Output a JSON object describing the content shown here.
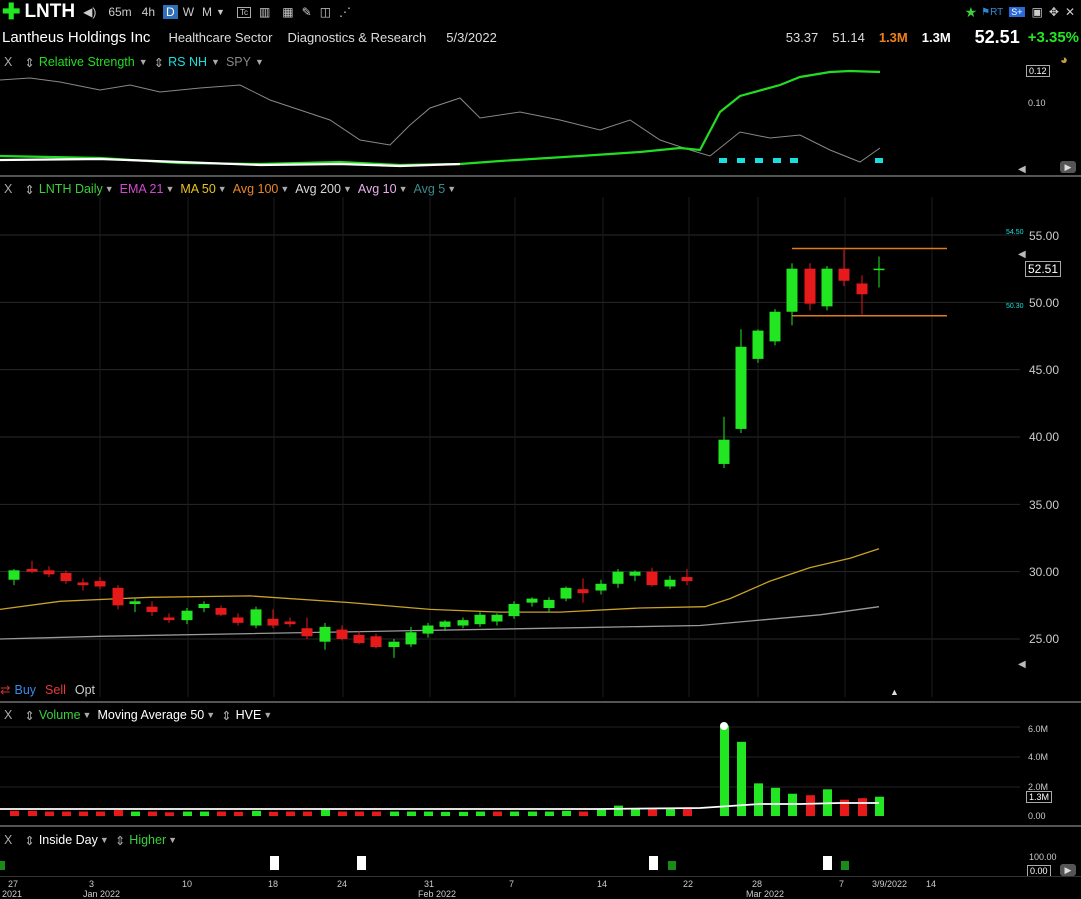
{
  "toolbar": {
    "symbol": "LNTH",
    "timeframes": [
      "65m",
      "4h",
      "D",
      "W",
      "M"
    ],
    "active_timeframe": "D"
  },
  "info": {
    "company": "Lantheus Holdings Inc",
    "sector": "Healthcare Sector",
    "industry": "Diagnostics & Research",
    "date": "5/3/2022",
    "high": "53.37",
    "low": "51.14",
    "vol_orange": "1.3M",
    "vol_white": "1.3M",
    "last": "52.51",
    "change": "+3.35%"
  },
  "rs_pane": {
    "close": "X",
    "label": "Relative Strength",
    "rsnh": "RS NH",
    "spy": "SPY",
    "tick_top": "0.12",
    "tick_mid": "0.10"
  },
  "price_pane": {
    "close": "X",
    "studies": [
      {
        "label": "LNTH Daily",
        "color": "#3ad13a"
      },
      {
        "label": "EMA 21",
        "color": "#d04ad0"
      },
      {
        "label": "MA 50",
        "color": "#e8c41a"
      },
      {
        "label": "Avg 100",
        "color": "#e8872a"
      },
      {
        "label": "Avg 200",
        "color": "#d8d8d8"
      },
      {
        "label": "Avg 10",
        "color": "#e8b0e8"
      },
      {
        "label": "Avg 5",
        "color": "#3a8a8a"
      }
    ],
    "ticks": [
      "55.00",
      "50.00",
      "45.00",
      "40.00",
      "35.00",
      "30.00",
      "25.00"
    ],
    "last_tag": "52.51",
    "level_high": "54.50",
    "level_low": "50.30",
    "buy": "Buy",
    "sell": "Sell",
    "opt": "Opt"
  },
  "volume_pane": {
    "close": "X",
    "label": "Volume",
    "ma": "Moving Average 50",
    "hve": "HVE",
    "ticks": [
      "6.0M",
      "4.0M",
      "2.0M",
      "0.00"
    ],
    "last_tag": "1.3M"
  },
  "inside_pane": {
    "close": "X",
    "label": "Inside Day",
    "higher": "Higher",
    "tick_top": "100.00",
    "tick_bot": "0.00"
  },
  "xaxis": {
    "labels": [
      {
        "t": "27",
        "sub": "2021"
      },
      {
        "t": "3",
        "sub": "Jan 2022"
      },
      {
        "t": "10",
        "sub": ""
      },
      {
        "t": "18",
        "sub": ""
      },
      {
        "t": "24",
        "sub": ""
      },
      {
        "t": "31",
        "sub": "Feb 2022"
      },
      {
        "t": "7",
        "sub": ""
      },
      {
        "t": "14",
        "sub": ""
      },
      {
        "t": "22",
        "sub": ""
      },
      {
        "t": "28",
        "sub": "Mar 2022"
      },
      {
        "t": "7",
        "sub": ""
      },
      {
        "t": "3/9/2022",
        "sub": ""
      },
      {
        "t": "14",
        "sub": ""
      }
    ]
  },
  "colors": {
    "up": "#22e622",
    "down": "#e61a1a",
    "ma50": "#c9a227",
    "ma200": "#9a9a9a",
    "level": "#e07a1a",
    "rs_line": "#22dd22",
    "spy_line": "#888888",
    "rsnh": "#19e0e0"
  },
  "chart_data": {
    "type": "candlestick",
    "ylim": [
      23,
      57
    ],
    "candles": [
      {
        "o": 29.4,
        "h": 30.2,
        "l": 29.0,
        "c": 30.1
      },
      {
        "o": 30.2,
        "h": 30.8,
        "l": 29.9,
        "c": 30.0
      },
      {
        "o": 30.1,
        "h": 30.4,
        "l": 29.6,
        "c": 29.8
      },
      {
        "o": 29.9,
        "h": 30.1,
        "l": 29.1,
        "c": 29.3
      },
      {
        "o": 29.2,
        "h": 29.5,
        "l": 28.6,
        "c": 29.0
      },
      {
        "o": 29.3,
        "h": 29.6,
        "l": 28.7,
        "c": 28.9
      },
      {
        "o": 28.8,
        "h": 29.0,
        "l": 27.2,
        "c": 27.5
      },
      {
        "o": 27.6,
        "h": 28.0,
        "l": 27.0,
        "c": 27.8
      },
      {
        "o": 27.4,
        "h": 27.8,
        "l": 26.7,
        "c": 27.0
      },
      {
        "o": 26.6,
        "h": 26.9,
        "l": 26.2,
        "c": 26.4
      },
      {
        "o": 26.4,
        "h": 27.3,
        "l": 26.1,
        "c": 27.1
      },
      {
        "o": 27.3,
        "h": 27.8,
        "l": 27.0,
        "c": 27.6
      },
      {
        "o": 27.3,
        "h": 27.5,
        "l": 26.7,
        "c": 26.8
      },
      {
        "o": 26.6,
        "h": 26.9,
        "l": 26.0,
        "c": 26.2
      },
      {
        "o": 26.0,
        "h": 27.4,
        "l": 25.8,
        "c": 27.2
      },
      {
        "o": 26.5,
        "h": 27.2,
        "l": 25.8,
        "c": 26.0
      },
      {
        "o": 26.3,
        "h": 26.6,
        "l": 25.9,
        "c": 26.1
      },
      {
        "o": 25.8,
        "h": 26.6,
        "l": 25.0,
        "c": 25.2
      },
      {
        "o": 24.8,
        "h": 26.2,
        "l": 24.2,
        "c": 25.9
      },
      {
        "o": 25.7,
        "h": 26.0,
        "l": 24.9,
        "c": 25.0
      },
      {
        "o": 25.3,
        "h": 25.6,
        "l": 24.6,
        "c": 24.7
      },
      {
        "o": 25.2,
        "h": 25.4,
        "l": 24.3,
        "c": 24.4
      },
      {
        "o": 24.4,
        "h": 25.0,
        "l": 23.6,
        "c": 24.8
      },
      {
        "o": 24.6,
        "h": 25.9,
        "l": 24.4,
        "c": 25.5
      },
      {
        "o": 25.4,
        "h": 26.2,
        "l": 25.1,
        "c": 26.0
      },
      {
        "o": 25.9,
        "h": 26.4,
        "l": 25.6,
        "c": 26.3
      },
      {
        "o": 26.0,
        "h": 26.6,
        "l": 25.8,
        "c": 26.4
      },
      {
        "o": 26.1,
        "h": 27.0,
        "l": 25.9,
        "c": 26.8
      },
      {
        "o": 26.3,
        "h": 26.9,
        "l": 26.0,
        "c": 26.8
      },
      {
        "o": 26.7,
        "h": 27.8,
        "l": 26.5,
        "c": 27.6
      },
      {
        "o": 27.7,
        "h": 28.1,
        "l": 27.4,
        "c": 28.0
      },
      {
        "o": 27.3,
        "h": 28.1,
        "l": 27.0,
        "c": 27.9
      },
      {
        "o": 28.0,
        "h": 28.9,
        "l": 27.8,
        "c": 28.8
      },
      {
        "o": 28.7,
        "h": 29.5,
        "l": 27.7,
        "c": 28.4
      },
      {
        "o": 28.6,
        "h": 29.4,
        "l": 28.3,
        "c": 29.1
      },
      {
        "o": 29.1,
        "h": 30.2,
        "l": 28.8,
        "c": 30.0
      },
      {
        "o": 29.7,
        "h": 30.1,
        "l": 29.3,
        "c": 30.0
      },
      {
        "o": 30.0,
        "h": 30.3,
        "l": 28.9,
        "c": 29.0
      },
      {
        "o": 28.9,
        "h": 29.7,
        "l": 28.7,
        "c": 29.4
      },
      {
        "o": 29.6,
        "h": 30.2,
        "l": 29.0,
        "c": 29.3
      },
      {
        "o": 38.0,
        "h": 41.5,
        "l": 37.7,
        "c": 39.8
      },
      {
        "o": 40.6,
        "h": 48.0,
        "l": 40.3,
        "c": 46.7
      },
      {
        "o": 45.8,
        "h": 48.0,
        "l": 45.5,
        "c": 47.9
      },
      {
        "o": 47.1,
        "h": 49.5,
        "l": 46.8,
        "c": 49.3
      },
      {
        "o": 49.3,
        "h": 52.9,
        "l": 48.3,
        "c": 52.5
      },
      {
        "o": 52.5,
        "h": 52.9,
        "l": 49.4,
        "c": 49.9
      },
      {
        "o": 49.7,
        "h": 52.7,
        "l": 49.4,
        "c": 52.5
      },
      {
        "o": 52.5,
        "h": 54.0,
        "l": 51.2,
        "c": 51.6
      },
      {
        "o": 51.4,
        "h": 52.0,
        "l": 49.1,
        "c": 50.6
      },
      {
        "o": 52.5,
        "h": 53.4,
        "l": 51.1,
        "c": 52.5
      }
    ],
    "candle_x": [
      14,
      32,
      49,
      66,
      83,
      100,
      118,
      135,
      152,
      169,
      187,
      204,
      221,
      238,
      256,
      273,
      290,
      307,
      325,
      342,
      359,
      376,
      394,
      411,
      428,
      445,
      463,
      480,
      497,
      514,
      532,
      549,
      566,
      583,
      601,
      618,
      635,
      652,
      670,
      687,
      724,
      741,
      758,
      775,
      792,
      810,
      827,
      844,
      862,
      879
    ],
    "ma50_points": [
      [
        0,
        27.2
      ],
      [
        60,
        27.8
      ],
      [
        150,
        28.1
      ],
      [
        250,
        28.2
      ],
      [
        350,
        27.7
      ],
      [
        430,
        27.2
      ],
      [
        500,
        27.0
      ],
      [
        560,
        27.0
      ],
      [
        640,
        27.3
      ],
      [
        705,
        27.4
      ],
      [
        730,
        28.0
      ],
      [
        770,
        29.3
      ],
      [
        810,
        30.3
      ],
      [
        850,
        31.0
      ],
      [
        879,
        31.7
      ]
    ],
    "ma200_points": [
      [
        0,
        25.0
      ],
      [
        100,
        25.2
      ],
      [
        250,
        25.4
      ],
      [
        400,
        25.6
      ],
      [
        550,
        25.8
      ],
      [
        700,
        26.0
      ],
      [
        760,
        26.4
      ],
      [
        820,
        26.8
      ],
      [
        879,
        27.4
      ]
    ],
    "levels": [
      54.0,
      49.0
    ],
    "level_x": [
      792,
      947
    ],
    "volume": [
      {
        "v": 0.35,
        "up": false
      },
      {
        "v": 0.35,
        "up": false
      },
      {
        "v": 0.3,
        "up": false
      },
      {
        "v": 0.3,
        "up": false
      },
      {
        "v": 0.3,
        "up": false
      },
      {
        "v": 0.3,
        "up": false
      },
      {
        "v": 0.4,
        "up": false
      },
      {
        "v": 0.3,
        "up": true
      },
      {
        "v": 0.3,
        "up": false
      },
      {
        "v": 0.25,
        "up": false
      },
      {
        "v": 0.3,
        "up": true
      },
      {
        "v": 0.3,
        "up": true
      },
      {
        "v": 0.3,
        "up": false
      },
      {
        "v": 0.28,
        "up": false
      },
      {
        "v": 0.35,
        "up": true
      },
      {
        "v": 0.28,
        "up": false
      },
      {
        "v": 0.3,
        "up": false
      },
      {
        "v": 0.3,
        "up": false
      },
      {
        "v": 0.45,
        "up": true
      },
      {
        "v": 0.3,
        "up": false
      },
      {
        "v": 0.3,
        "up": false
      },
      {
        "v": 0.3,
        "up": false
      },
      {
        "v": 0.3,
        "up": true
      },
      {
        "v": 0.3,
        "up": true
      },
      {
        "v": 0.3,
        "up": true
      },
      {
        "v": 0.28,
        "up": true
      },
      {
        "v": 0.28,
        "up": true
      },
      {
        "v": 0.3,
        "up": true
      },
      {
        "v": 0.3,
        "up": false
      },
      {
        "v": 0.3,
        "up": true
      },
      {
        "v": 0.3,
        "up": true
      },
      {
        "v": 0.3,
        "up": true
      },
      {
        "v": 0.35,
        "up": true
      },
      {
        "v": 0.3,
        "up": false
      },
      {
        "v": 0.5,
        "up": true
      },
      {
        "v": 0.7,
        "up": true
      },
      {
        "v": 0.5,
        "up": true
      },
      {
        "v": 0.5,
        "up": false
      },
      {
        "v": 0.5,
        "up": true
      },
      {
        "v": 0.5,
        "up": false
      },
      {
        "v": 6.1,
        "up": true
      },
      {
        "v": 5.0,
        "up": true
      },
      {
        "v": 2.2,
        "up": true
      },
      {
        "v": 1.9,
        "up": true
      },
      {
        "v": 1.5,
        "up": true
      },
      {
        "v": 1.4,
        "up": false
      },
      {
        "v": 1.8,
        "up": true
      },
      {
        "v": 1.1,
        "up": false
      },
      {
        "v": 1.2,
        "up": false
      },
      {
        "v": 1.3,
        "up": true
      }
    ],
    "volume_ylim": [
      0,
      7.0
    ]
  }
}
